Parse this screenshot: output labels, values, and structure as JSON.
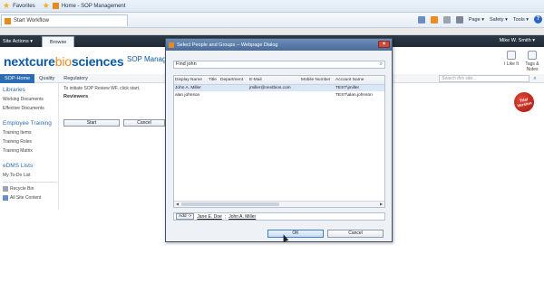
{
  "browser": {
    "favorites_label": "Favorites",
    "tab_title": "Home - SOP Management",
    "page_tab": "Start Workflow",
    "tools": [
      "Page ▾",
      "Safety ▾",
      "Tools ▾"
    ],
    "help": "?"
  },
  "ribbon": {
    "site_actions": "Site Actions ▾",
    "browse_tab": "Browse",
    "user": "Mike W. Smith ▾"
  },
  "title_area": {
    "logo_prefix": "nextcure",
    "logo_mid": "bio",
    "logo_suffix": "sciences",
    "site_title": "SOP Managem",
    "like_label": "I Like It",
    "tags_label": "Tags & Notes"
  },
  "topnav": {
    "items": [
      "SOP-Home",
      "Quality",
      "Regulatory"
    ],
    "search_placeholder": "Search this site..."
  },
  "leftnav": {
    "libraries_head": "Libraries",
    "libraries": [
      "Working Documents",
      "Effective Documents"
    ],
    "training_head": "Employee Training",
    "training": [
      "Training Items",
      "Training Roles",
      "Training Matrix"
    ],
    "edms_head": "eDMS Lists",
    "edms": [
      "My To-Do List"
    ],
    "recycle": "Recycle Bin",
    "all_content": "All Site Content"
  },
  "content": {
    "intro": "To initiate SOP Review WF, click start.",
    "reviewers_label": "Reviewers",
    "start_label": "Start",
    "cancel_label": "Cancel"
  },
  "trial_badge": "Trial Version",
  "dialog": {
    "title": "Select People and Groups -- Webpage Dialog",
    "find_value": "Find john",
    "columns": [
      "Display Name",
      "Title",
      "Department",
      "E-Mail",
      "Mobile Number",
      "Account Name"
    ],
    "rows": [
      {
        "display_name": "John A. Miller",
        "title": "",
        "department": "",
        "email": "jmiller@nextbios.com",
        "mobile": "",
        "account": "TEST\\jmiller"
      },
      {
        "display_name": "alan johnson",
        "title": "",
        "department": "",
        "email": "",
        "mobile": "",
        "account": "TEST\\alan.johnson"
      }
    ],
    "add_label": "Add ->",
    "selected_people": [
      "Jane E. Doe",
      "John A. Miller"
    ],
    "ok_label": "OK",
    "cancel_label": "Cancel"
  }
}
